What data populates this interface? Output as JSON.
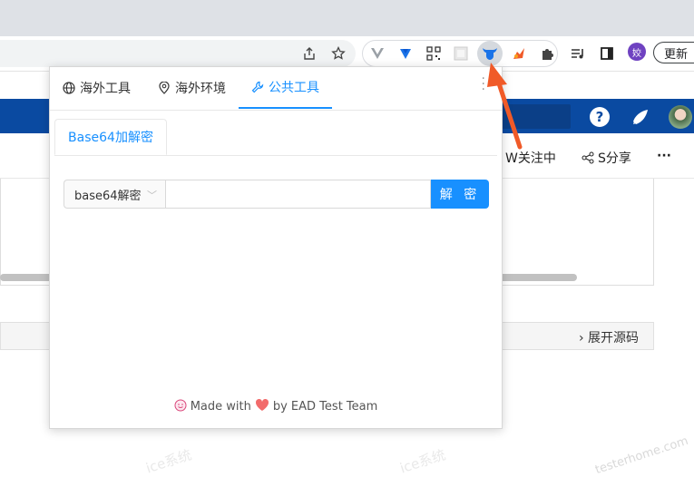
{
  "browser": {
    "profile_initial": "姣",
    "update_label": "更新",
    "active_extension_color": "#1a73e8"
  },
  "page": {
    "action_follow": "W关注中",
    "action_share": "S分享",
    "more_label": "···",
    "expand_source": "展开源码",
    "watermark_text": "testerhome.com",
    "watermark_text_2": "ice系统",
    "help_label": "?",
    "header_color": "#0a4aa1"
  },
  "popup": {
    "tabs": [
      {
        "label": "海外工具",
        "icon": "globe-icon"
      },
      {
        "label": "海外环境",
        "icon": "location-icon"
      },
      {
        "label": "公共工具",
        "icon": "wrench-icon",
        "active": true
      }
    ],
    "sub_tab": "Base64加解密",
    "select_value": "base64解密",
    "input_value": "",
    "input_placeholder": "",
    "action_button": "解 密",
    "footer": {
      "prefix": "Made with",
      "suffix": "by EAD Test Team"
    },
    "accent": "#1890ff"
  },
  "annotation": {
    "arrow_color": "#f05a28"
  }
}
